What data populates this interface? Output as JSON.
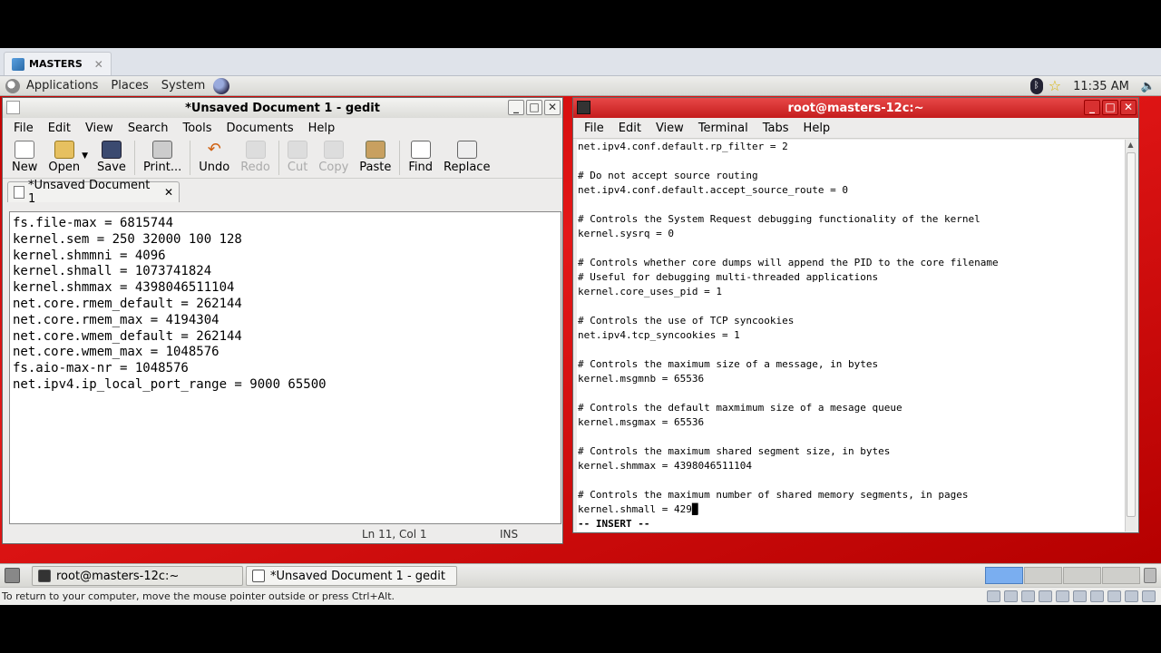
{
  "vm": {
    "tab_label": "MASTERS",
    "tab_close": "✕",
    "status_hint": "To return to your computer, move the mouse pointer outside or press Ctrl+Alt."
  },
  "panel": {
    "applications": "Applications",
    "places": "Places",
    "system": "System",
    "clock": "11:35 AM"
  },
  "gedit": {
    "title": "*Unsaved Document 1 - gedit",
    "menu": [
      "File",
      "Edit",
      "View",
      "Search",
      "Tools",
      "Documents",
      "Help"
    ],
    "toolbar": {
      "new": "New",
      "open": "Open",
      "save": "Save",
      "print": "Print...",
      "undo": "Undo",
      "redo": "Redo",
      "cut": "Cut",
      "copy": "Copy",
      "paste": "Paste",
      "find": "Find",
      "replace": "Replace"
    },
    "tab_label": "*Unsaved Document 1",
    "tab_close": "✕",
    "lines": [
      "fs.file-max = 6815744",
      "kernel.sem = 250 32000 100 128",
      "kernel.shmmni = 4096",
      "kernel.shmall = 1073741824",
      "kernel.shmmax = 4398046511104",
      "net.core.rmem_default = 262144",
      "net.core.rmem_max = 4194304",
      "net.core.wmem_default = 262144",
      "net.core.wmem_max = 1048576",
      "fs.aio-max-nr = 1048576",
      "net.ipv4.ip_local_port_range = 9000 65500"
    ],
    "status_position": "Ln 11, Col 1",
    "status_mode": "INS"
  },
  "terminal": {
    "title": "root@masters-12c:~",
    "menu": [
      "File",
      "Edit",
      "View",
      "Terminal",
      "Tabs",
      "Help"
    ],
    "lines": [
      "net.ipv4.conf.default.rp_filter = 2",
      "",
      "# Do not accept source routing",
      "net.ipv4.conf.default.accept_source_route = 0",
      "",
      "# Controls the System Request debugging functionality of the kernel",
      "kernel.sysrq = 0",
      "",
      "# Controls whether core dumps will append the PID to the core filename",
      "# Useful for debugging multi-threaded applications",
      "kernel.core_uses_pid = 1",
      "",
      "# Controls the use of TCP syncookies",
      "net.ipv4.tcp_syncookies = 1",
      "",
      "# Controls the maximum size of a message, in bytes",
      "kernel.msgmnb = 65536",
      "",
      "# Controls the default maxmimum size of a mesage queue",
      "kernel.msgmax = 65536",
      "",
      "# Controls the maximum shared segment size, in bytes",
      "kernel.shmmax = 4398046511104",
      "",
      "# Controls the maximum number of shared memory segments, in pages"
    ],
    "current_line": "kernel.shmall = 429",
    "mode_line": "-- INSERT --"
  },
  "taskbar": {
    "terminal_task": "root@masters-12c:~",
    "gedit_task": "*Unsaved Document 1 - gedit"
  }
}
